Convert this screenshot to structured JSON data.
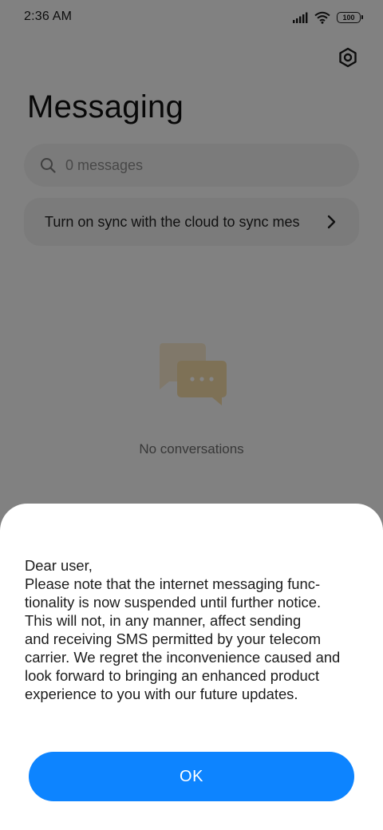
{
  "status_bar": {
    "time": "2:36 AM",
    "battery": "100",
    "icons": [
      "signal-icon",
      "wifi-icon",
      "battery-icon"
    ]
  },
  "header": {
    "title": "Messaging",
    "settings_icon": "gear-icon"
  },
  "search": {
    "placeholder": "0 messages",
    "icon": "search-icon"
  },
  "sync_banner": {
    "text": "Turn on sync with the cloud to sync mes",
    "icon": "chevron-right-icon"
  },
  "empty_state": {
    "icon": "chat-bubbles-icon",
    "text": "No conversations"
  },
  "dialog": {
    "message": "Dear user,\nPlease note that the internet messaging func-\ntionality is now suspended until further notice.\nThis will not, in any manner, affect sending\nand receiving SMS permitted by your telecom\ncarrier. We regret the inconvenience caused and\nlook forward to bringing an enhanced product\nexperience to you with our future updates.",
    "ok_label": "OK"
  },
  "colors": {
    "accent": "#0d84ff",
    "overlay": "rgba(0,0,0,0.48)",
    "illustration": "#f2d9a6"
  }
}
